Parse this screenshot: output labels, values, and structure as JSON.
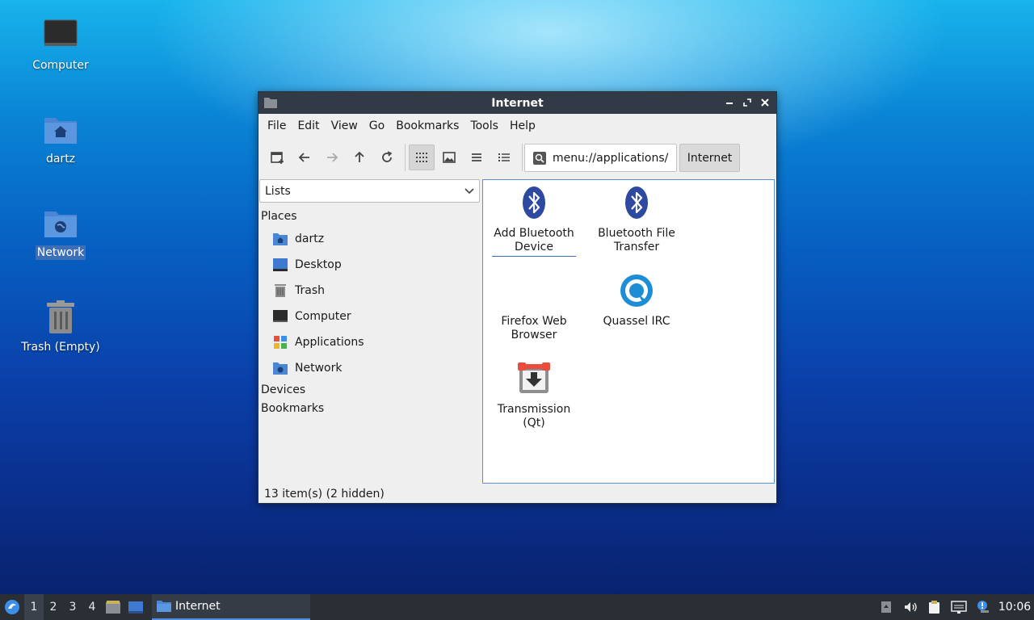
{
  "desktop": {
    "icons": [
      {
        "label": "Computer"
      },
      {
        "label": "dartz"
      },
      {
        "label": "Network"
      },
      {
        "label": "Trash (Empty)"
      }
    ]
  },
  "window": {
    "title": "Internet",
    "menu": [
      "File",
      "Edit",
      "View",
      "Go",
      "Bookmarks",
      "Tools",
      "Help"
    ],
    "path": "menu://applications/",
    "breadcrumb": "Internet",
    "sidebar": {
      "selector": "Lists",
      "places_heading": "Places",
      "places": [
        {
          "label": "dartz",
          "icon": "home-folder-icon"
        },
        {
          "label": "Desktop",
          "icon": "desktop-icon"
        },
        {
          "label": "Trash",
          "icon": "trash-icon"
        },
        {
          "label": "Computer",
          "icon": "computer-icon"
        },
        {
          "label": "Applications",
          "icon": "applications-icon"
        },
        {
          "label": "Network",
          "icon": "network-folder-icon"
        }
      ],
      "devices_heading": "Devices",
      "bookmarks_heading": "Bookmarks"
    },
    "items": [
      {
        "label": "Add Bluetooth Device",
        "icon": "bluetooth-icon"
      },
      {
        "label": "Bluetooth File Transfer",
        "icon": "bluetooth-icon"
      },
      {
        "label": "Firefox Web Browser",
        "icon": "firefox-icon"
      },
      {
        "label": "Quassel IRC",
        "icon": "quassel-icon"
      },
      {
        "label": "Transmission (Qt)",
        "icon": "transmission-icon"
      }
    ],
    "status": "13 item(s) (2 hidden)"
  },
  "taskbar": {
    "desktops": [
      "1",
      "2",
      "3",
      "4"
    ],
    "active_task": "Internet",
    "clock": "10:06"
  },
  "colors": {
    "accent": "#3d6fb8",
    "titlebar": "#323a45",
    "taskbar": "#2a2f36",
    "bluetooth": "#2d4aa0"
  }
}
